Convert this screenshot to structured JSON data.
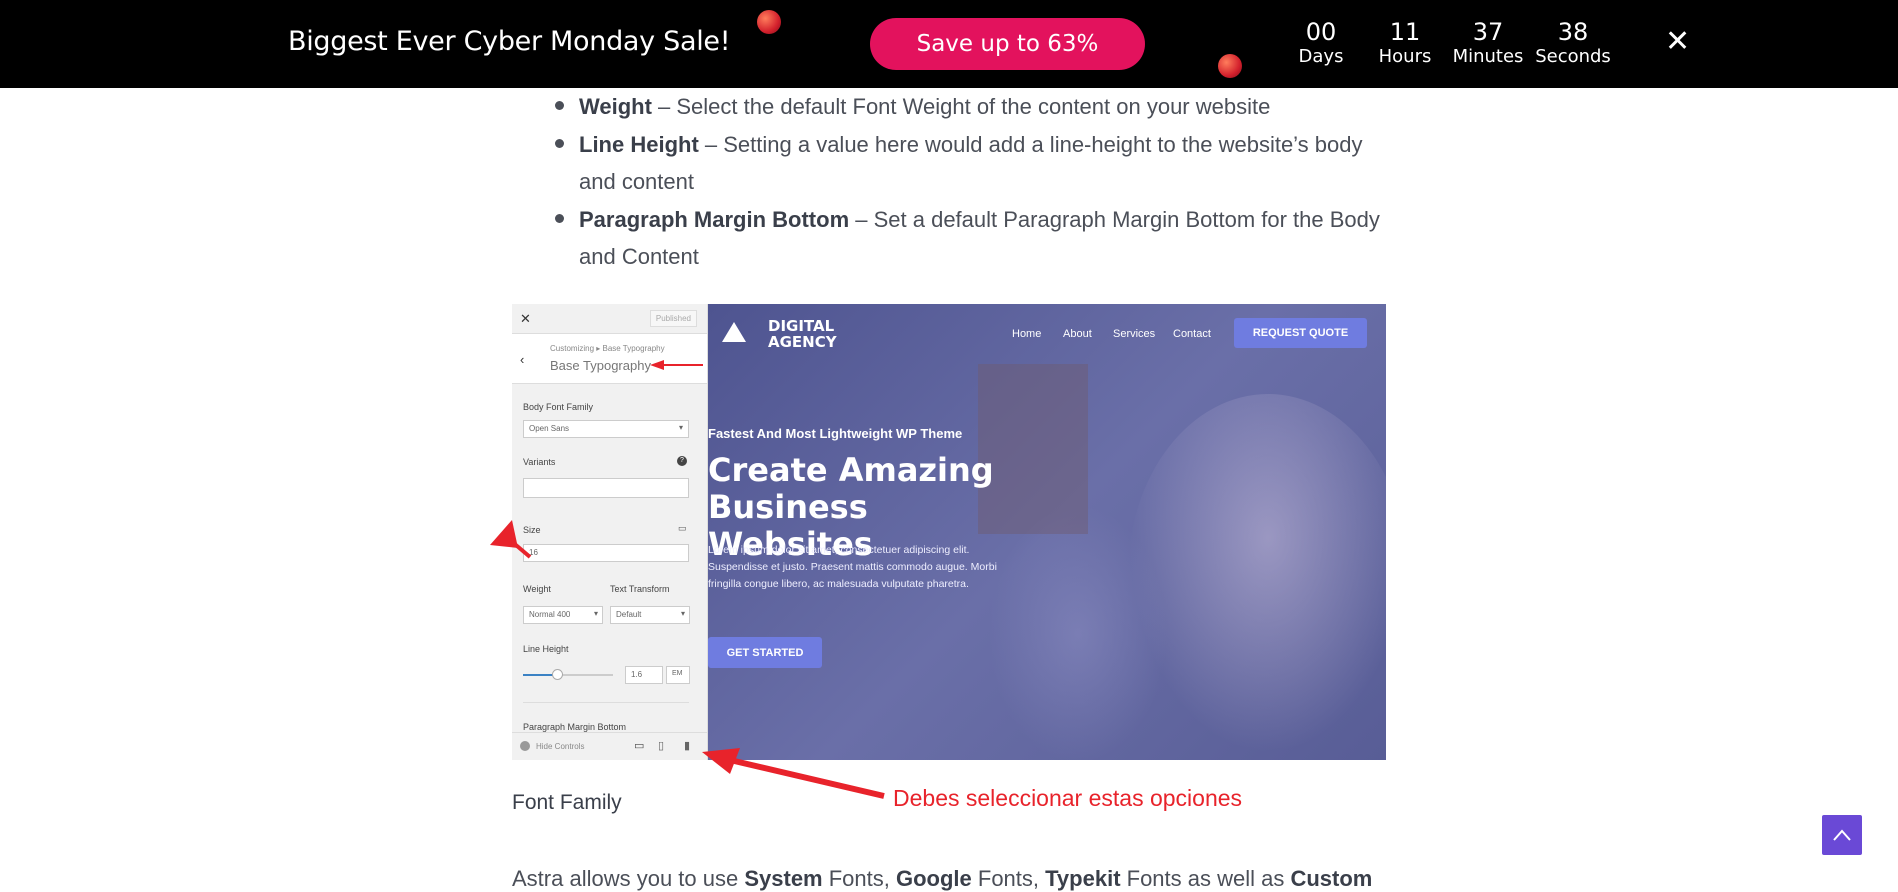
{
  "promo": {
    "title": "Biggest Ever Cyber Monday Sale!",
    "cta": "Save up to 63%",
    "countdown": [
      {
        "value": "00",
        "label": "Days"
      },
      {
        "value": "11",
        "label": "Hours"
      },
      {
        "value": "37",
        "label": "Minutes"
      },
      {
        "value": "38",
        "label": "Seconds"
      }
    ],
    "close": "✕"
  },
  "bullets": [
    {
      "term": "Weight",
      "text": " – Select the default Font Weight of the content on your website"
    },
    {
      "term": "Line Height",
      "text": " – Setting a value here would add a line-height to the website’s body and content"
    },
    {
      "term": "Paragraph Margin Bottom",
      "text": " – Set a default Paragraph Margin Bottom for the Body and Content"
    }
  ],
  "screenshot": {
    "panel": {
      "published": "Published",
      "crumb_small": "Customizing ▸ Base Typography",
      "crumb_title": "Base Typography",
      "body_font_family_label": "Body Font Family",
      "body_font_family_value": "Open Sans",
      "variants_label": "Variants",
      "size_label": "Size",
      "size_value": "16",
      "weight_label": "Weight",
      "weight_value": "Normal 400",
      "transform_label": "Text Transform",
      "transform_value": "Default",
      "line_height_label": "Line Height",
      "line_height_value": "1.6",
      "line_height_unit": "EM",
      "pmb_label": "Paragraph Margin Bottom",
      "hide_controls": "Hide Controls"
    },
    "site": {
      "logo_line1": "DIGITAL",
      "logo_line2": "AGENCY",
      "nav": [
        "Home",
        "About",
        "Services",
        "Contact"
      ],
      "quote_btn": "REQUEST QUOTE",
      "tagline": "Fastest And Most Lightweight WP Theme",
      "headline_1": "Create Amazing",
      "headline_2": "Business Websites",
      "paragraph": "Lorem ipsum dolor sit amet, consectetuer adipiscing elit. Suspendisse et justo. Praesent mattis commodo augue. Morbi fringilla congue libero, ac malesuada vulputate pharetra.",
      "cta": "GET STARTED"
    }
  },
  "annotation": "Debes seleccionar estas opciones",
  "font_family_heading": "Font Family",
  "last_paragraph": {
    "p1": "Astra allows you to use ",
    "b1": "System",
    "p2": " Fonts, ",
    "b2": "Google",
    "p3": " Fonts, ",
    "b3": "Typekit",
    "p4": " Fonts as well as ",
    "b4": "Custom"
  },
  "colors": {
    "promo_button": "#e3125d",
    "annotation_red": "#e8232b",
    "scroll_top": "#6a49d6",
    "site_overlay": "#575d95",
    "site_button": "#6f7ce0"
  }
}
